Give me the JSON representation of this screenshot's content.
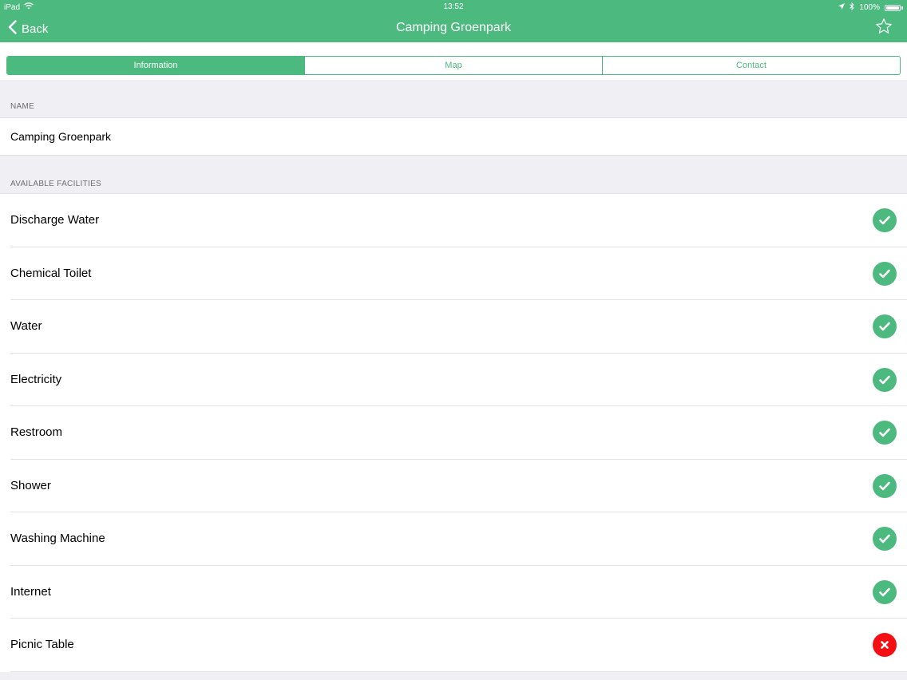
{
  "status_bar": {
    "device": "iPad",
    "time": "13:52",
    "battery": "100%"
  },
  "nav": {
    "back_label": "Back",
    "title": "Camping Groenpark"
  },
  "tabs": [
    {
      "label": "Information",
      "active": true
    },
    {
      "label": "Map",
      "active": false
    },
    {
      "label": "Contact",
      "active": false
    }
  ],
  "name_section": {
    "header": "NAME",
    "value": "Camping Groenpark"
  },
  "facilities": {
    "header": "AVAILABLE FACILITIES",
    "items": [
      {
        "label": "Discharge Water",
        "available": true
      },
      {
        "label": "Chemical Toilet",
        "available": true
      },
      {
        "label": "Water",
        "available": true
      },
      {
        "label": "Electricity",
        "available": true
      },
      {
        "label": "Restroom",
        "available": true
      },
      {
        "label": "Shower",
        "available": true
      },
      {
        "label": "Washing Machine",
        "available": true
      },
      {
        "label": "Internet",
        "available": true
      },
      {
        "label": "Picnic Table",
        "available": false
      }
    ]
  },
  "colors": {
    "accent": "#4cba7f",
    "unavailable": "#f40f12"
  }
}
